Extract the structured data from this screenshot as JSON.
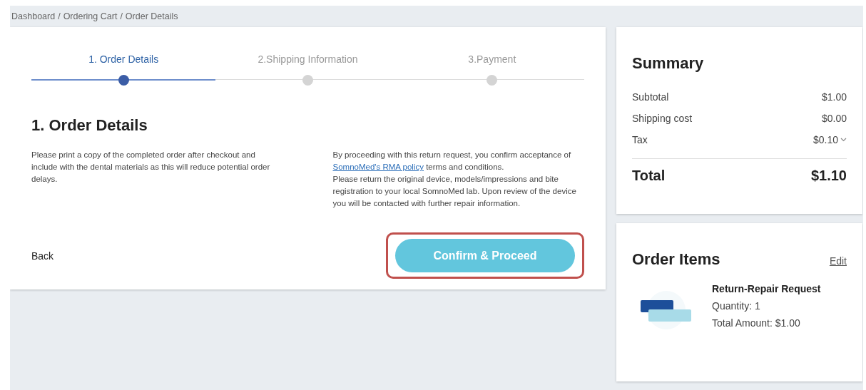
{
  "breadcrumb": {
    "separators": [
      "/",
      "/"
    ],
    "links": [
      "Dashboard",
      "Ordering Cart",
      "Order Details"
    ]
  },
  "steps": [
    {
      "label": "1. Order Details",
      "selected": true
    },
    {
      "label": "2.Shipping Information",
      "selected": false
    },
    {
      "label": "3.Payment",
      "selected": false
    }
  ],
  "heading": "1. Order Details",
  "left_note": "Please print a copy of the completed order after checkout and include with the dental materials as this will reduce potential order delays.",
  "right_note": {
    "before": "By proceeding with this return request, you confirm acceptance of",
    "link": "SomnoMed's RMA policy",
    "after": "terms and conditions.",
    "second": "Please return the original device, models/impressions and bite registration to your local SomnoMed lab. Upon review of the device you will be contacted with further repair information."
  },
  "back": "Back",
  "confirm": {
    "label": "Confirm & Proceed",
    "highlighted": true
  },
  "summary": {
    "title": "Summary",
    "rows": [
      {
        "label": "Subtotal",
        "value": "$1.00",
        "kind": "plain"
      },
      {
        "label": "Shipping cost",
        "value": "$0.00",
        "kind": "plain"
      },
      {
        "label": "Tax",
        "value": "$0.10",
        "kind": "dropdown"
      }
    ],
    "total_label": "Total",
    "total_value": "$1.10"
  },
  "order_items": {
    "title": "Order Items",
    "edit": "Edit",
    "items": [
      {
        "name": "Return-Repair Request",
        "quantity": "Quantity: 1",
        "amount": "Total Amount: $1.00"
      }
    ]
  }
}
